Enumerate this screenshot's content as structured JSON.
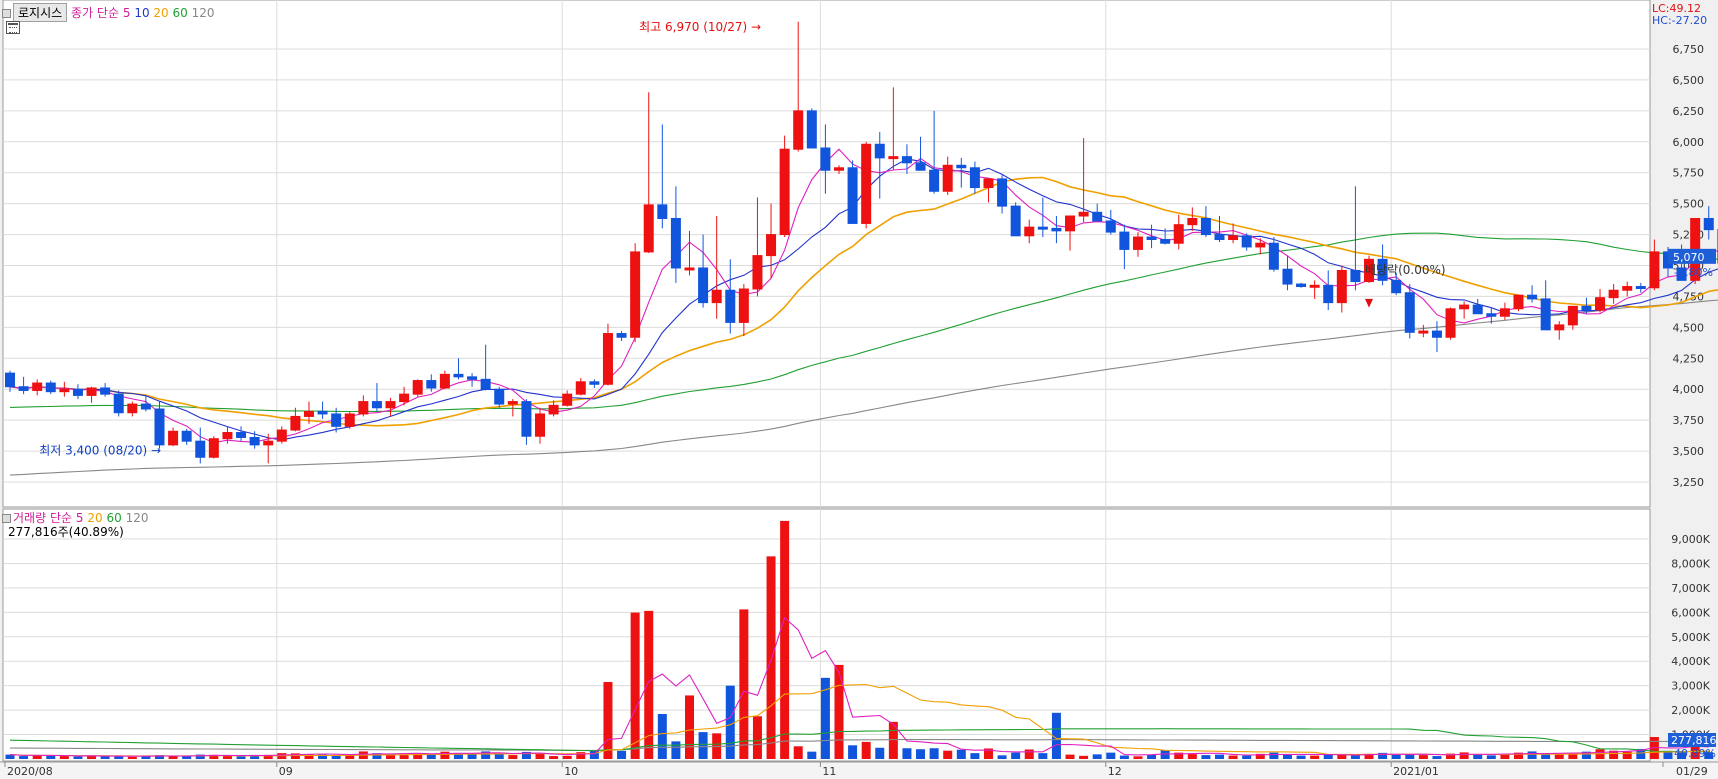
{
  "header": {
    "stock_name": "로지시스",
    "legend_close": "종가",
    "legend_ma_type": "단순",
    "ma_periods": [
      "5",
      "10",
      "20",
      "60",
      "120"
    ],
    "lc": "LC:49.12",
    "hc": "HC:-27.20"
  },
  "volume_header": {
    "label": "거래량",
    "ma_type": "단순",
    "ma_periods": [
      "5",
      "20",
      "60",
      "120"
    ],
    "value_text": "277,816주(40.89%)"
  },
  "price_badge": {
    "value": "5,070",
    "change": "-3.80%"
  },
  "volume_badge": {
    "value": "277,816",
    "pct": "40.89%"
  },
  "colors": {
    "up": "#ee1111",
    "down": "#1155dd",
    "ma5": "#e020c0",
    "ma10": "#2233cc",
    "ma20": "#f0a000",
    "ma60": "#22a033",
    "ma120": "#888888"
  },
  "chart_data": {
    "type": "candlestick",
    "price_axis": {
      "min": 3250,
      "max": 6750,
      "ticks": [
        "3,250",
        "3,500",
        "3,750",
        "4,000",
        "4,250",
        "4,500",
        "4,750",
        "5,000",
        "5,250",
        "5,500",
        "5,750",
        "6,000",
        "6,250",
        "6,500",
        "6,750"
      ]
    },
    "volume_axis": {
      "unit": "K",
      "ticks": [
        "1,000K",
        "2,000K",
        "3,000K",
        "4,000K",
        "5,000K",
        "6,000K",
        "7,000K",
        "8,000K",
        "9,000K"
      ]
    },
    "x_labels": [
      {
        "label": "2020/08",
        "index": 0
      },
      {
        "label": "09",
        "index": 20
      },
      {
        "label": "10",
        "index": 41
      },
      {
        "label": "11",
        "index": 60
      },
      {
        "label": "12",
        "index": 81
      },
      {
        "label": "2021/01",
        "index": 102
      },
      {
        "label": "01/29",
        "index": 122
      }
    ],
    "annotations": {
      "high": {
        "text": "최고 6,970 (10/27)",
        "index": 56,
        "value": 6970
      },
      "low": {
        "text": "최저 3,400 (08/20)",
        "index": 12,
        "value": 3400
      },
      "ex_dividend": {
        "text": "배당락(0.00%)",
        "index": 100
      }
    },
    "ohlc": [
      [
        4130,
        4150,
        3980,
        4020
      ],
      [
        4020,
        4100,
        3960,
        3990
      ],
      [
        3990,
        4080,
        3950,
        4050
      ],
      [
        4050,
        4070,
        3960,
        3980
      ],
      [
        3980,
        4060,
        3940,
        4000
      ],
      [
        4000,
        4040,
        3920,
        3950
      ],
      [
        3950,
        4020,
        3890,
        4010
      ],
      [
        4010,
        4050,
        3940,
        3960
      ],
      [
        3960,
        3990,
        3780,
        3810
      ],
      [
        3810,
        3900,
        3780,
        3880
      ],
      [
        3880,
        3950,
        3820,
        3840
      ],
      [
        3840,
        3900,
        3520,
        3550
      ],
      [
        3550,
        3690,
        3540,
        3660
      ],
      [
        3660,
        3680,
        3550,
        3580
      ],
      [
        3580,
        3690,
        3400,
        3450
      ],
      [
        3450,
        3620,
        3440,
        3600
      ],
      [
        3600,
        3700,
        3560,
        3650
      ],
      [
        3650,
        3700,
        3580,
        3610
      ],
      [
        3610,
        3660,
        3520,
        3550
      ],
      [
        3550,
        3640,
        3400,
        3580
      ],
      [
        3580,
        3700,
        3560,
        3670
      ],
      [
        3670,
        3850,
        3660,
        3780
      ],
      [
        3780,
        3900,
        3720,
        3820
      ],
      [
        3820,
        3900,
        3760,
        3800
      ],
      [
        3800,
        3850,
        3650,
        3700
      ],
      [
        3700,
        3820,
        3680,
        3800
      ],
      [
        3800,
        3950,
        3780,
        3900
      ],
      [
        3900,
        4050,
        3820,
        3850
      ],
      [
        3850,
        3930,
        3780,
        3900
      ],
      [
        3900,
        4020,
        3870,
        3960
      ],
      [
        3960,
        4080,
        3940,
        4070
      ],
      [
        4070,
        4120,
        3980,
        4010
      ],
      [
        4010,
        4150,
        4000,
        4120
      ],
      [
        4120,
        4250,
        4080,
        4100
      ],
      [
        4100,
        4130,
        4020,
        4080
      ],
      [
        4080,
        4360,
        3990,
        4000
      ],
      [
        4000,
        4020,
        3850,
        3880
      ],
      [
        3880,
        3920,
        3780,
        3900
      ],
      [
        3900,
        3920,
        3550,
        3620
      ],
      [
        3620,
        3850,
        3560,
        3800
      ],
      [
        3800,
        3910,
        3780,
        3870
      ],
      [
        3870,
        3990,
        3860,
        3960
      ],
      [
        3960,
        4090,
        3950,
        4060
      ],
      [
        4060,
        4080,
        4010,
        4040
      ],
      [
        4040,
        4530,
        4030,
        4450
      ],
      [
        4450,
        4470,
        4390,
        4420
      ],
      [
        4420,
        5180,
        4380,
        5110
      ],
      [
        5110,
        6400,
        5100,
        5490
      ],
      [
        5490,
        6140,
        5300,
        5380
      ],
      [
        5380,
        5640,
        4860,
        4980
      ],
      [
        4980,
        5280,
        4920,
        4980
      ],
      [
        4980,
        5250,
        4660,
        4700
      ],
      [
        4700,
        5400,
        4570,
        4800
      ],
      [
        4800,
        5050,
        4450,
        4540
      ],
      [
        4540,
        4850,
        4430,
        4810
      ],
      [
        4810,
        5550,
        4750,
        5080
      ],
      [
        5080,
        5500,
        4890,
        5250
      ],
      [
        5250,
        6050,
        5230,
        5940
      ],
      [
        5940,
        6970,
        5920,
        6250
      ],
      [
        6250,
        6270,
        6190,
        5950
      ],
      [
        5950,
        6140,
        5580,
        5770
      ],
      [
        5770,
        5810,
        5740,
        5790
      ],
      [
        5790,
        5850,
        5360,
        5340
      ],
      [
        5340,
        6000,
        5300,
        5980
      ],
      [
        5980,
        6080,
        5540,
        5870
      ],
      [
        5870,
        6440,
        5770,
        5880
      ],
      [
        5880,
        5980,
        5740,
        5830
      ],
      [
        5830,
        6040,
        5780,
        5770
      ],
      [
        5770,
        6250,
        5580,
        5600
      ],
      [
        5600,
        5880,
        5570,
        5810
      ],
      [
        5810,
        5870,
        5630,
        5790
      ],
      [
        5790,
        5840,
        5580,
        5630
      ],
      [
        5630,
        5680,
        5510,
        5700
      ],
      [
        5700,
        5730,
        5420,
        5480
      ],
      [
        5480,
        5510,
        5300,
        5240
      ],
      [
        5240,
        5370,
        5180,
        5310
      ],
      [
        5310,
        5550,
        5230,
        5300
      ],
      [
        5300,
        5400,
        5180,
        5280
      ],
      [
        5280,
        5390,
        5120,
        5400
      ],
      [
        5400,
        6030,
        5350,
        5430
      ],
      [
        5430,
        5500,
        5360,
        5360
      ],
      [
        5360,
        5450,
        5250,
        5270
      ],
      [
        5270,
        5330,
        4970,
        5130
      ],
      [
        5130,
        5270,
        5070,
        5230
      ],
      [
        5230,
        5330,
        5140,
        5210
      ],
      [
        5210,
        5300,
        5170,
        5180
      ],
      [
        5180,
        5410,
        5130,
        5330
      ],
      [
        5330,
        5470,
        5280,
        5380
      ],
      [
        5380,
        5480,
        5230,
        5250
      ],
      [
        5250,
        5400,
        5190,
        5210
      ],
      [
        5210,
        5340,
        5180,
        5240
      ],
      [
        5240,
        5260,
        5120,
        5150
      ],
      [
        5150,
        5220,
        5090,
        5180
      ],
      [
        5180,
        5230,
        4950,
        4970
      ],
      [
        4970,
        5080,
        4800,
        4850
      ],
      [
        4850,
        4860,
        4820,
        4830
      ],
      [
        4830,
        4880,
        4730,
        4840
      ],
      [
        4840,
        4960,
        4640,
        4700
      ],
      [
        4700,
        5000,
        4620,
        4960
      ],
      [
        4960,
        5640,
        4800,
        4870
      ],
      [
        4870,
        5080,
        4860,
        5050
      ],
      [
        5050,
        5170,
        4840,
        4880
      ],
      [
        4880,
        4940,
        4760,
        4780
      ],
      [
        4780,
        4850,
        4410,
        4460
      ],
      [
        4460,
        4520,
        4420,
        4470
      ],
      [
        4470,
        4550,
        4300,
        4420
      ],
      [
        4420,
        4660,
        4400,
        4650
      ],
      [
        4650,
        4710,
        4570,
        4680
      ],
      [
        4680,
        4730,
        4610,
        4610
      ],
      [
        4610,
        4660,
        4530,
        4590
      ],
      [
        4590,
        4700,
        4560,
        4650
      ],
      [
        4650,
        4740,
        4630,
        4760
      ],
      [
        4760,
        4840,
        4700,
        4730
      ],
      [
        4730,
        4880,
        4540,
        4480
      ],
      [
        4480,
        4550,
        4400,
        4520
      ],
      [
        4520,
        4660,
        4480,
        4670
      ],
      [
        4670,
        4740,
        4610,
        4640
      ],
      [
        4640,
        4810,
        4620,
        4740
      ],
      [
        4740,
        4850,
        4690,
        4800
      ],
      [
        4800,
        4870,
        4750,
        4830
      ],
      [
        4830,
        4860,
        4780,
        4820
      ],
      [
        4820,
        5210,
        4800,
        5110
      ],
      [
        5110,
        5150,
        4910,
        4980
      ],
      [
        4980,
        5170,
        4910,
        4880
      ],
      [
        4880,
        5360,
        4850,
        5380
      ],
      [
        5380,
        5480,
        5210,
        5290
      ],
      [
        5290,
        5600,
        5000,
        5020
      ],
      [
        5270,
        5260,
        5120,
        5070
      ]
    ],
    "volume_k": [
      180,
      120,
      160,
      130,
      120,
      100,
      140,
      110,
      130,
      90,
      110,
      160,
      120,
      110,
      180,
      170,
      150,
      110,
      120,
      170,
      240,
      230,
      200,
      180,
      130,
      170,
      310,
      240,
      200,
      180,
      240,
      210,
      300,
      230,
      190,
      310,
      230,
      160,
      290,
      210,
      120,
      130,
      280,
      330,
      3150,
      330,
      5990,
      6060,
      1840,
      720,
      2600,
      1100,
      1050,
      3000,
      6120,
      1750,
      8290,
      9740,
      520,
      300,
      3320,
      3850,
      560,
      700,
      460,
      1520,
      440,
      400,
      440,
      340,
      380,
      240,
      430,
      150,
      260,
      390,
      240,
      1890,
      180,
      130,
      190,
      260,
      140,
      110,
      180,
      360,
      260,
      200,
      160,
      180,
      140,
      140,
      210,
      260,
      200,
      140,
      140,
      190,
      180,
      150,
      210,
      250,
      170,
      190,
      160,
      120,
      220,
      270,
      200,
      150,
      190,
      260,
      310,
      220,
      180,
      240,
      300,
      400,
      340,
      300,
      410,
      900,
      330,
      320,
      650,
      277
    ]
  }
}
